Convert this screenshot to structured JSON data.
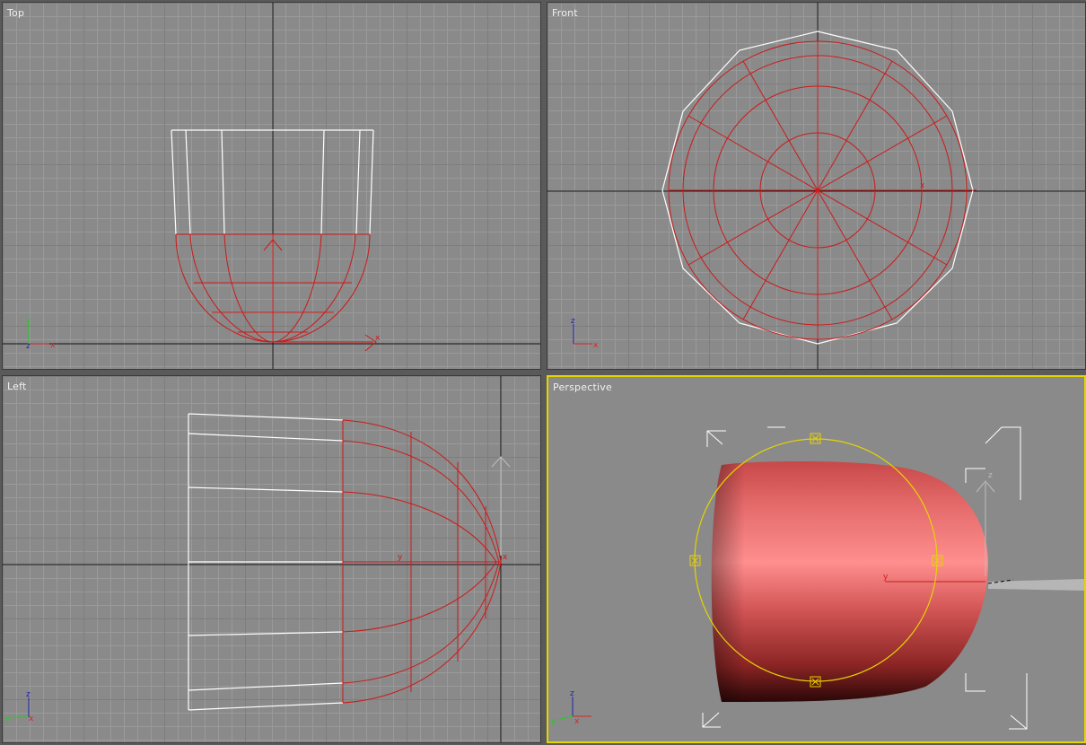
{
  "viewports": {
    "top": {
      "label": "Top"
    },
    "front": {
      "label": "Front"
    },
    "left": {
      "label": "Left"
    },
    "perspective": {
      "label": "Perspective"
    }
  },
  "axis_labels": {
    "x": "x",
    "y": "y",
    "z": "z"
  },
  "colors": {
    "viewport_bg": "#8a8a8a",
    "grid": "#9a9a9a",
    "mesh_selected": "#cc1a1a",
    "mesh_white": "#ffffff",
    "active_border": "#e6d400",
    "object_fill": "#e86b6b"
  }
}
